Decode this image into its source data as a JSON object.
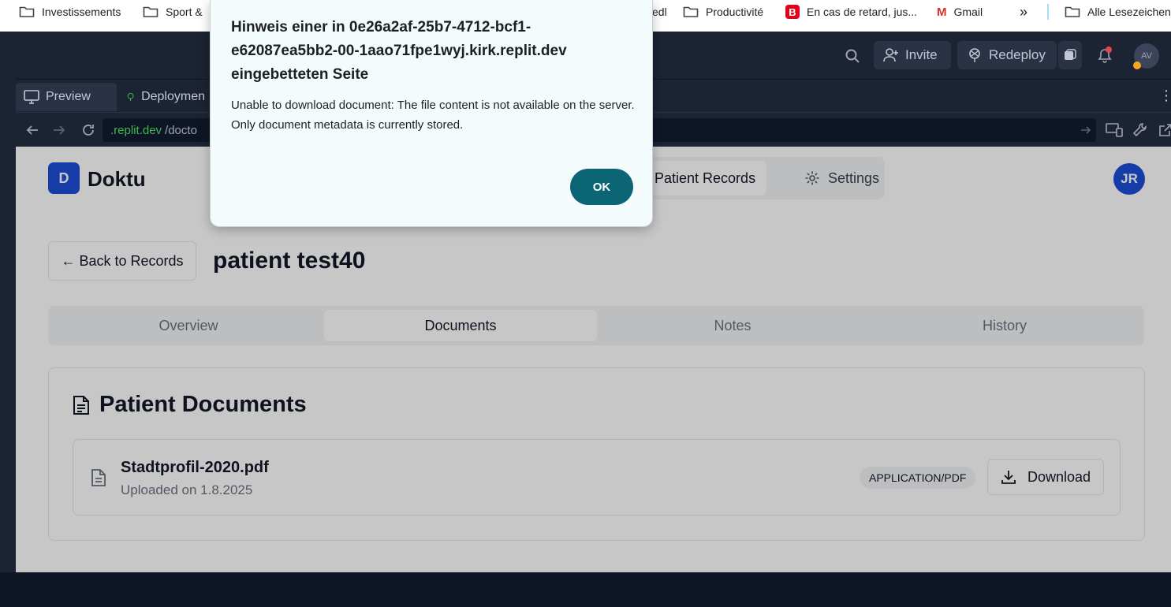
{
  "bookmarks": {
    "items": [
      {
        "label": "Investissements",
        "icon": "folder-icon"
      },
      {
        "label": "Sport &",
        "icon": "folder-icon"
      },
      {
        "label": "edl",
        "icon": ""
      },
      {
        "label": "Productivité",
        "icon": "folder-icon"
      },
      {
        "label": "En cas de retard, jus...",
        "icon": "b-logo-icon"
      },
      {
        "label": "Gmail",
        "icon": "gmail-icon"
      }
    ],
    "more": "»",
    "all_bookmarks": "Alle Lesezeichen"
  },
  "replit": {
    "invite_label": "Invite",
    "redeploy_label": "Redeploy",
    "avatar_initials": "AV",
    "tabs": [
      {
        "label": "Preview",
        "icon": "monitor-icon"
      },
      {
        "label": "Deploymen",
        "icon": "deploy-icon"
      }
    ],
    "url": {
      "domain": ".replit.dev",
      "path": "/docto"
    }
  },
  "app": {
    "logo_letter": "D",
    "brand": "Doktu",
    "nav": {
      "patient_records": "Patient Records",
      "settings": "Settings"
    },
    "user_initials": "JR",
    "back_label": "← Back to Records",
    "patient_name": "patient test40",
    "tabs": [
      {
        "label": "Overview",
        "active": false
      },
      {
        "label": "Documents",
        "active": true
      },
      {
        "label": "Notes",
        "active": false
      },
      {
        "label": "History",
        "active": false
      }
    ],
    "documents": {
      "title": "Patient Documents",
      "files": [
        {
          "name": "Stadtprofil-2020.pdf",
          "uploaded": "Uploaded on 1.8.2025",
          "mime": "APPLICATION/PDF",
          "download_label": "Download"
        }
      ]
    }
  },
  "dialog": {
    "title": "Hinweis einer in 0e26a2af-25b7-4712-bcf1-e62087ea5bb2-00-1aao71fpe1wyj.kirk.replit.dev eingebetteten Seite",
    "message": "Unable to download document: The file content is not available on the server. Only document metadata is currently stored.",
    "ok_label": "OK"
  },
  "colors": {
    "brand_blue": "#1d4ed8",
    "dialog_button": "#0c6575",
    "replit_bg": "#1c2333"
  }
}
